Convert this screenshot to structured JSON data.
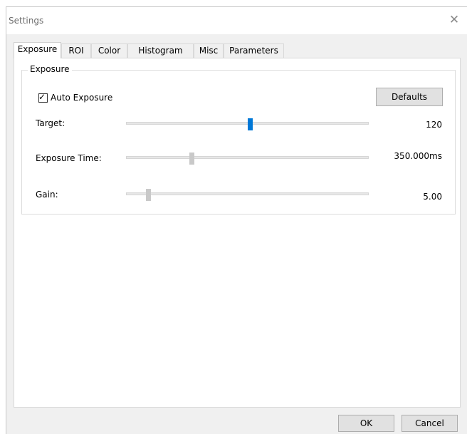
{
  "window": {
    "title": "Settings",
    "close_icon": "close-icon"
  },
  "tabs": [
    {
      "label": "Exposure",
      "selected": true
    },
    {
      "label": "ROI"
    },
    {
      "label": "Color"
    },
    {
      "label": "Histogram"
    },
    {
      "label": "Misc"
    },
    {
      "label": "Parameters"
    }
  ],
  "exposure_group": {
    "title": "Exposure",
    "auto_exposure": {
      "label": "Auto Exposure",
      "checked": true
    },
    "defaults_label": "Defaults",
    "rows": [
      {
        "label": "Target:",
        "value": "120",
        "level": 0.51,
        "active": true
      },
      {
        "label": "Exposure Time:",
        "value": "350.000ms",
        "level": 0.27,
        "active": false
      },
      {
        "label": "Gain:",
        "value": "5.00",
        "level": 0.09,
        "active": false
      }
    ]
  },
  "buttons": {
    "ok": "OK",
    "cancel": "Cancel"
  },
  "colors": {
    "slider_active": "#0078d7",
    "slider_inactive": "#c9c9c9"
  }
}
